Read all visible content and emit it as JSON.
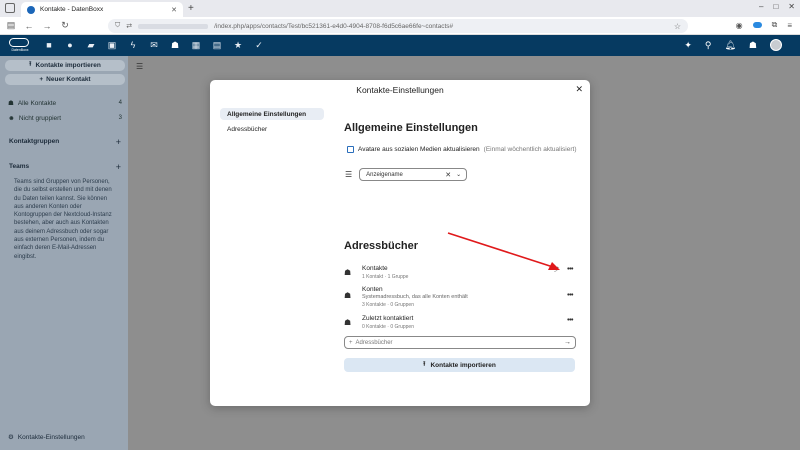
{
  "browser": {
    "tab_title": "Kontakte - DatenBoxx",
    "url_text": "/index.php/apps/contacts/Test/bc521361-e4d0-4904-8708-f6d5c6ae66fe~contacts#"
  },
  "app_header": {
    "logo_text": "DatenBoxx",
    "apps": [
      "dashboard-icon",
      "search-icon",
      "files-icon",
      "photos-icon",
      "activity-icon",
      "mail-icon",
      "contacts-icon",
      "calendar-icon",
      "notes-icon",
      "favorites-icon",
      "tasks-icon"
    ]
  },
  "sidebar": {
    "import_label": "Kontakte importieren",
    "new_contact_label": "Neuer Kontakt",
    "items": [
      {
        "label": "Alle Kontakte",
        "count": "4"
      },
      {
        "label": "Nicht gruppiert",
        "count": "3"
      }
    ],
    "groups_heading": "Kontaktgruppen",
    "teams_heading": "Teams",
    "teams_text": "Teams sind Gruppen von Personen, die du selbst erstellen und mit denen du Daten teilen kannst. Sie können aus anderen Konten oder Kontogruppen der Nextcloud-Instanz bestehen, aber auch aus Kontakten aus deinem Adressbuch oder sogar aus externen Personen, indem du einfach deren E-Mail-Adressen eingibst.",
    "settings_label": "Kontakte-Einstellungen"
  },
  "modal": {
    "title": "Kontakte-Einstellungen",
    "nav": [
      "Allgemeine Einstellungen",
      "Adressbücher"
    ],
    "general_title": "Allgemeine Einstellungen",
    "avatar_checkbox_label": "Avatare aus sozialen Medien aktualisieren",
    "avatar_checkbox_hint": "(Einmal wöchentlich aktualisiert)",
    "sort_value": "Anzeigename",
    "addressbooks_title": "Adressbücher",
    "addressbooks": [
      {
        "name": "Kontakte",
        "desc": "",
        "sub": "1 Kontakt · 1 Gruppe"
      },
      {
        "name": "Konten",
        "desc": "Systemadressbuch, das alle Konten enthält",
        "sub": "3 Kontakte · 0 Gruppen"
      },
      {
        "name": "Zuletzt kontaktiert",
        "desc": "",
        "sub": "0 Kontakte · 0 Gruppen"
      }
    ],
    "new_addressbook_placeholder": "Adressbücher",
    "import_button_label": "Kontakte importieren"
  },
  "colors": {
    "header": "#063a61",
    "annotation_arrow": "#e0191b",
    "accent": "#2a6ebb"
  }
}
